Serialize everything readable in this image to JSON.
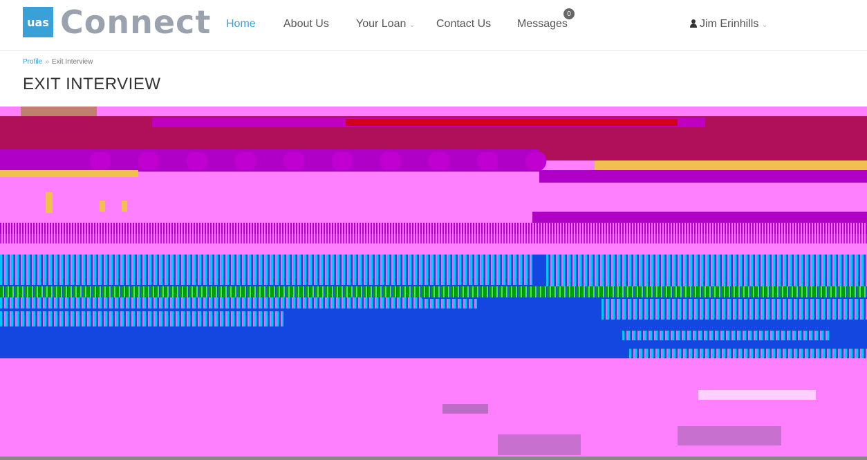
{
  "brand": {
    "badge": "uas",
    "wordmark": "Connect"
  },
  "nav": {
    "home": "Home",
    "about": "About Us",
    "loan": "Your Loan",
    "contact": "Contact Us",
    "messages": "Messages",
    "messages_count": "0",
    "user": "Jim Erinhills"
  },
  "breadcrumb": {
    "profile": "Profile",
    "current": "Exit Interview"
  },
  "page": {
    "title": "EXIT INTERVIEW"
  },
  "colors": {
    "accent": "#3aa0d8",
    "brand_gray": "#9aa3ad"
  },
  "icons": {
    "user": "user-icon",
    "dropdown": "chevron-down-icon"
  }
}
